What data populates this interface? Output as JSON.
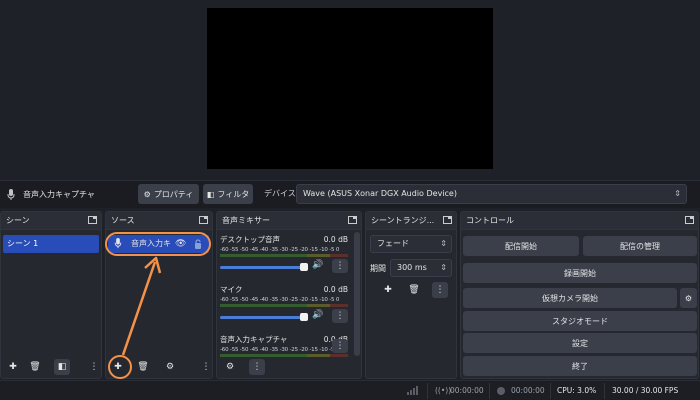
{
  "colors": {
    "accent": "#284cb8",
    "highlight": "#f4924a",
    "bg": "#1f2128"
  },
  "source_bar": {
    "icon": "microphone-icon",
    "name": "音声入力キャプチャ",
    "properties_label": "プロパティ",
    "filters_label": "フィルタ",
    "device_label": "デバイス",
    "device_value": "Wave (ASUS Xonar DGX Audio Device)"
  },
  "docks": {
    "scenes": {
      "title": "シーン",
      "items": [
        "シーン 1"
      ]
    },
    "sources": {
      "title": "ソース",
      "items": [
        {
          "name": "音声入力キ",
          "icon": "microphone-icon",
          "visible": true,
          "locked": false
        }
      ]
    },
    "mixer": {
      "title": "音声ミキサー",
      "scale": "-60 -55 -50 -45 -40 -35 -30 -25 -20 -15 -10 -5 0",
      "channels": [
        {
          "name": "デスクトップ音声",
          "db": "0.0 dB"
        },
        {
          "name": "マイク",
          "db": "0.0 dB"
        },
        {
          "name": "音声入力キャプチャ",
          "db": "0.0 dB"
        }
      ]
    },
    "transitions": {
      "title": "シーントランジ...",
      "type": "フェード",
      "duration_label": "期間",
      "duration": "300 ms"
    },
    "controls": {
      "title": "コントロール",
      "start_streaming": "配信開始",
      "manage_broadcast": "配信の管理",
      "start_recording": "録画開始",
      "start_virtual_camera": "仮想カメラ開始",
      "studio_mode": "スタジオモード",
      "settings": "設定",
      "exit": "終了"
    }
  },
  "status": {
    "stream_time": "00:00:00",
    "record_time": "00:00:00",
    "cpu": "CPU: 3.0%",
    "fps": "30.00 / 30.00 FPS"
  }
}
